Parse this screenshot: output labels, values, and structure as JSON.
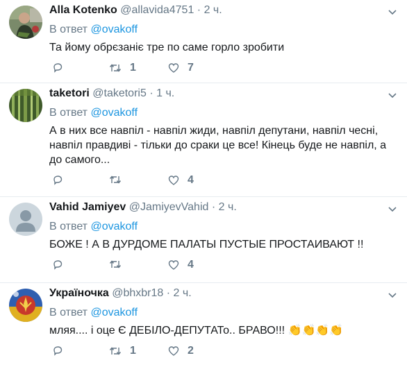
{
  "tweets": [
    {
      "name": "Alla Kotenko",
      "handle": "@allavida4751",
      "dot": "·",
      "time": "2 ч.",
      "reply_prefix": "В ответ",
      "reply_mention": "@ovakoff",
      "text": "Та йому обрєзаніє тре по саме горло зробити",
      "retweets": "1",
      "likes": "7",
      "avatar": "photo-man-green"
    },
    {
      "name": "taketori",
      "handle": "@taketori5",
      "dot": "·",
      "time": "1 ч.",
      "reply_prefix": "В ответ",
      "reply_mention": "@ovakoff",
      "text": "А в них все навпіл - навпіл жиди, навпіл депутани, навпіл чеснi, навпіл правдиві - тільки до сраки це все! Кінець буде не навпіл, а до самого...",
      "retweets": "",
      "likes": "4",
      "avatar": "bamboo-forest"
    },
    {
      "name": "Vahid Jamiyev",
      "handle": "@JamiyevVahid",
      "dot": "·",
      "time": "2 ч.",
      "reply_prefix": "В ответ",
      "reply_mention": "@ovakoff",
      "text": "БОЖЕ !  А В ДУРДОМЕ ПАЛАТЫ  ПУСТЫЕ ПРОСТАИВАЮТ !!",
      "retweets": "",
      "likes": "4",
      "avatar": "default-silhouette"
    },
    {
      "name": "Україночка",
      "handle": "@bhxbr18",
      "dot": "·",
      "time": "2 ч.",
      "reply_prefix": "В ответ",
      "reply_mention": "@ovakoff",
      "text": "мляя.... і оце  Є ДЕБІЛО-ДЕПУТАТо.. БРАВО!!! 👏👏👏👏",
      "retweets": "1",
      "likes": "2",
      "avatar": "ukrainian-emblem"
    }
  ],
  "colors": {
    "mention": "#1b95e0",
    "secondary": "#657786",
    "divider": "#e6ecf0"
  }
}
